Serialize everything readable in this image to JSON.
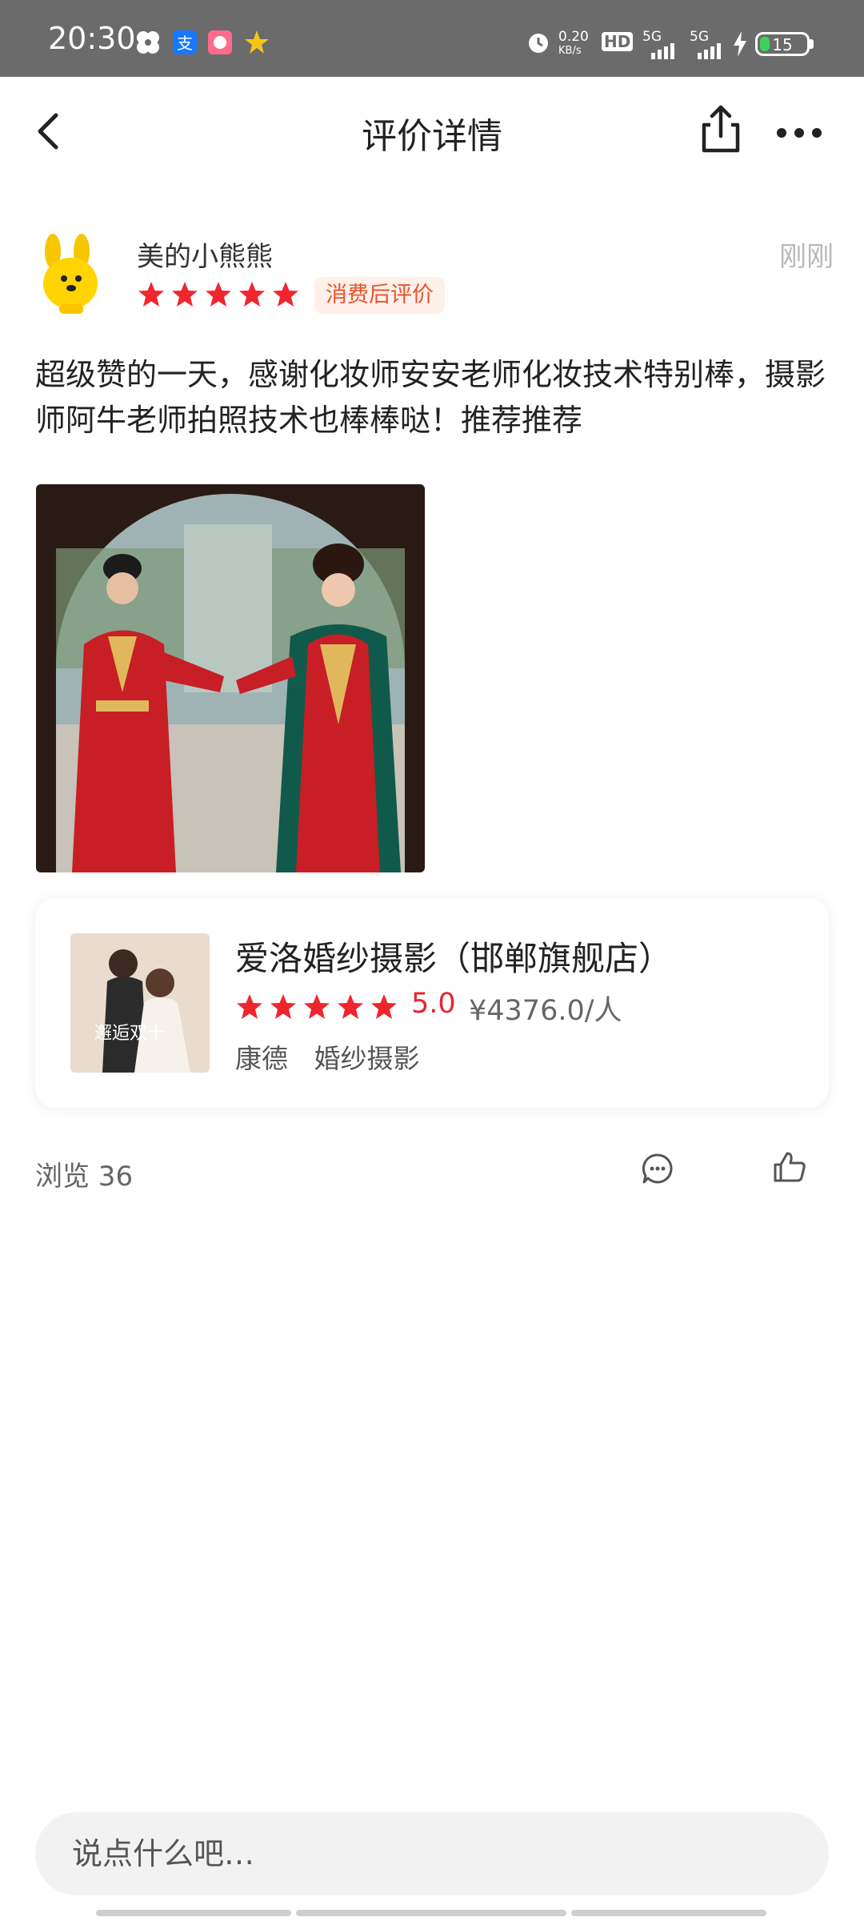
{
  "status_bar": {
    "time": "20:30",
    "net_speed_top": "0.20",
    "net_speed_bottom": "KB/s",
    "hd_label": "HD",
    "sim1_label": "5G",
    "sim2_label": "5G",
    "battery_level": "15",
    "battery_color": "#3fcf5a"
  },
  "nav": {
    "title": "评价详情",
    "back_icon": "chevron-left-icon",
    "share_icon": "share-icon",
    "more_icon": "more-dots-icon"
  },
  "review": {
    "username": "美的小熊熊",
    "time": "刚刚",
    "rating": 5,
    "badge": "消费后评价",
    "text": "超级赞的一天，感谢化妆师安安老师化妆技术特别棒，摄影师阿牛老师拍照技术也棒棒哒！推荐推荐"
  },
  "shop": {
    "name": "爱洛婚纱摄影（邯郸旗舰店）",
    "rating": 5,
    "score": "5.0",
    "price": "¥4376.0/人",
    "area": "康德",
    "category": "婚纱摄影",
    "thumb_caption": "邂逅双十"
  },
  "stats": {
    "views": "浏览 36"
  },
  "comment_input": {
    "placeholder": "说点什么吧…"
  },
  "colors": {
    "star": "#f0262f",
    "badge_text": "#e8542a",
    "badge_bg": "#fff0ea",
    "score": "#e8232c"
  }
}
